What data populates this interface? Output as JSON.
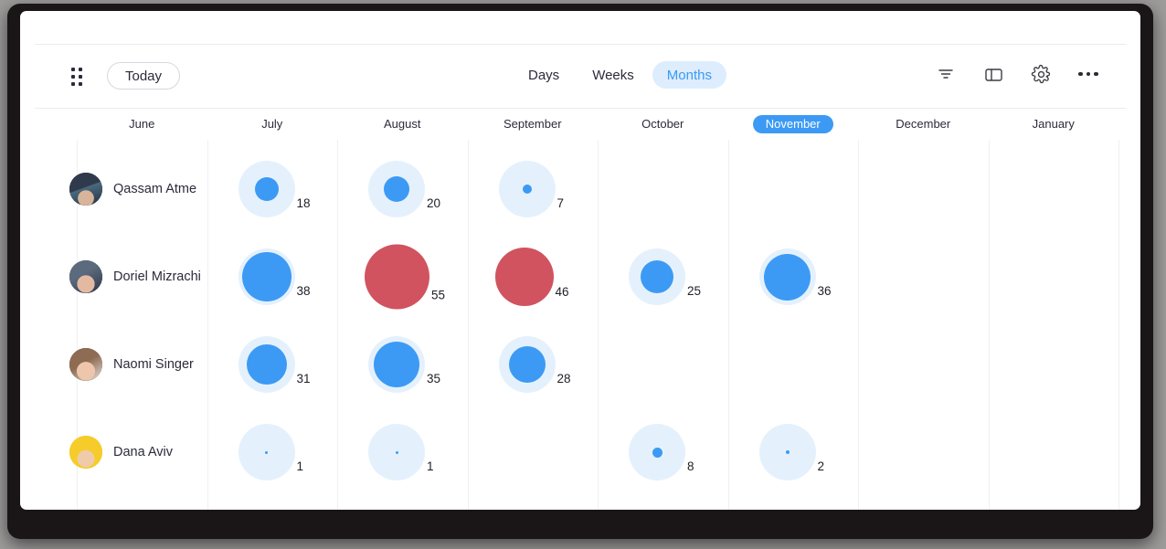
{
  "toolbar": {
    "grip_icon": "grip-dots-icon",
    "today_label": "Today",
    "view_modes": [
      {
        "label": "Days",
        "active": false
      },
      {
        "label": "Weeks",
        "active": false
      },
      {
        "label": "Months",
        "active": true
      }
    ],
    "tools": [
      {
        "name": "filter-icon",
        "glyph": "filter"
      },
      {
        "name": "panel-toggle-icon",
        "glyph": "panel"
      },
      {
        "name": "settings-gear-icon",
        "glyph": "gear"
      },
      {
        "name": "more-options-icon",
        "glyph": "dots"
      }
    ]
  },
  "colors": {
    "accent_blue": "#3c9af4",
    "halo_blue": "#e4f1fd",
    "alert_red": "#d0535f",
    "active_pill_bg": "#ddedfd",
    "grid_line": "#f0f0f3",
    "text": "#2b2b3c"
  },
  "columns": [
    {
      "label": "June",
      "current": false
    },
    {
      "label": "July",
      "current": false
    },
    {
      "label": "August",
      "current": false
    },
    {
      "label": "September",
      "current": false
    },
    {
      "label": "October",
      "current": false
    },
    {
      "label": "November",
      "current": true
    },
    {
      "label": "December",
      "current": false
    },
    {
      "label": "January",
      "current": false
    }
  ],
  "rows": [
    {
      "name": "Qassam Atme",
      "avatar_bg": "#3d3a44",
      "cells": [
        {
          "value": null
        },
        {
          "value": 18,
          "style": "halo"
        },
        {
          "value": 20,
          "style": "halo"
        },
        {
          "value": 7,
          "style": "halo"
        },
        {
          "value": null
        },
        {
          "value": null
        },
        {
          "value": null
        },
        {
          "value": null
        }
      ]
    },
    {
      "name": "Doriel Mizrachi",
      "avatar_bg": "#3f4a58",
      "cells": [
        {
          "value": null
        },
        {
          "value": 38,
          "style": "halo"
        },
        {
          "value": 55,
          "style": "solid"
        },
        {
          "value": 46,
          "style": "solid"
        },
        {
          "value": 25,
          "style": "halo"
        },
        {
          "value": 36,
          "style": "halo"
        },
        {
          "value": null
        },
        {
          "value": null
        }
      ]
    },
    {
      "name": "Naomi Singer",
      "avatar_bg": "#6d5a4e",
      "cells": [
        {
          "value": null
        },
        {
          "value": 31,
          "style": "halo"
        },
        {
          "value": 35,
          "style": "halo"
        },
        {
          "value": 28,
          "style": "halo"
        },
        {
          "value": null
        },
        {
          "value": null
        },
        {
          "value": null
        },
        {
          "value": null
        }
      ]
    },
    {
      "name": "Dana Aviv",
      "avatar_bg": "#f5cc2a",
      "cells": [
        {
          "value": null
        },
        {
          "value": 1,
          "style": "halo"
        },
        {
          "value": 1,
          "style": "halo"
        },
        {
          "value": null
        },
        {
          "value": 8,
          "style": "halo"
        },
        {
          "value": 2,
          "style": "halo"
        },
        {
          "value": null
        },
        {
          "value": null
        }
      ]
    }
  ]
}
